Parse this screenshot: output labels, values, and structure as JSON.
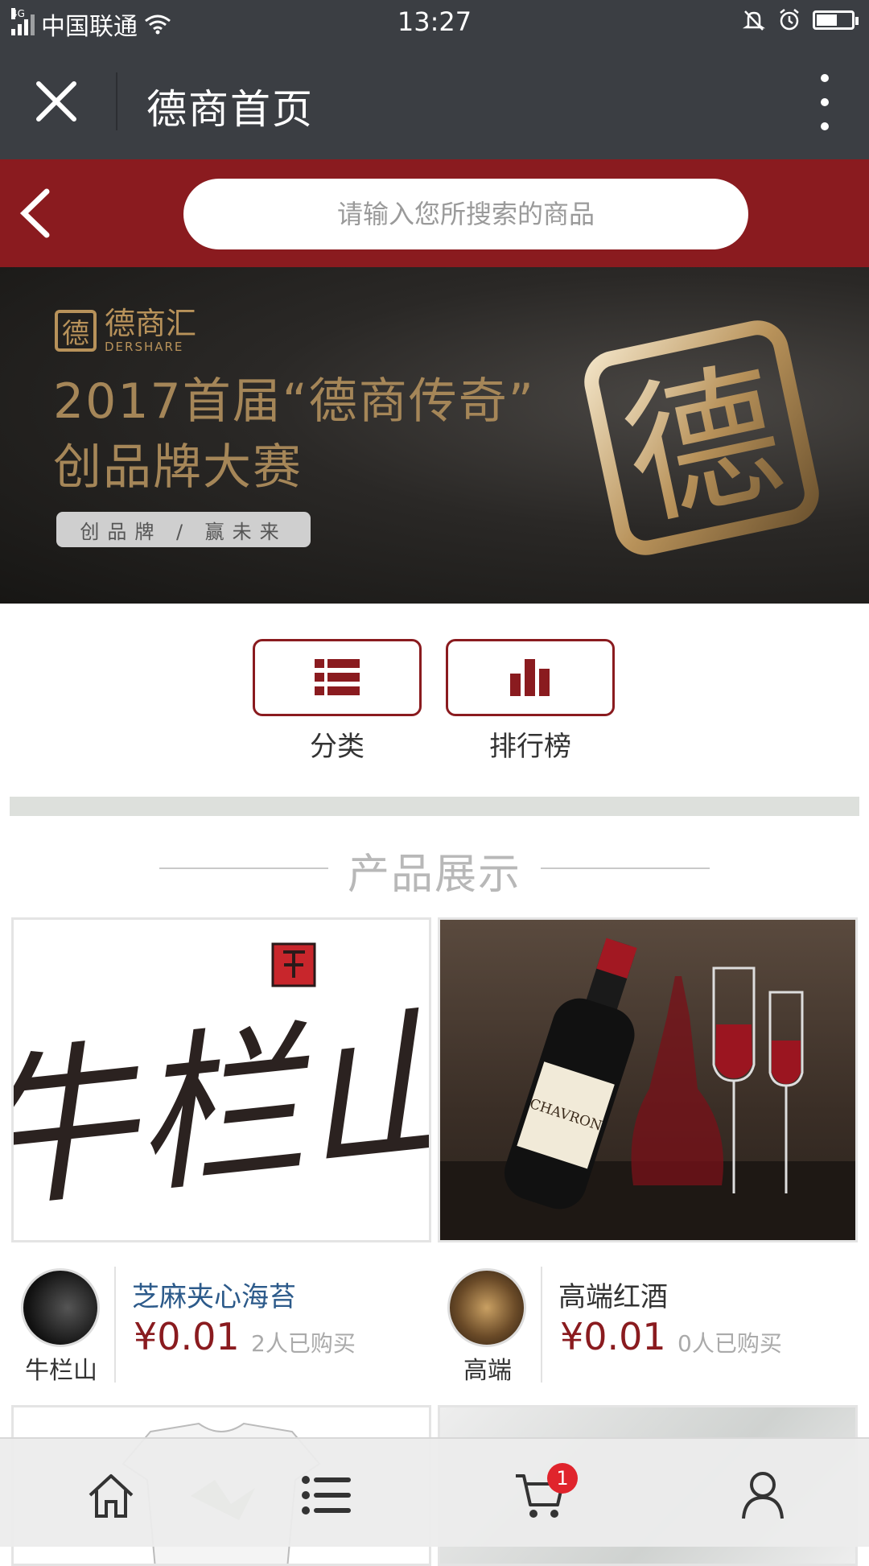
{
  "status_bar": {
    "network": "4G",
    "carrier": "中国联通",
    "time": "13:27",
    "battery_level": 0.55
  },
  "title_bar": {
    "title": "德商首页",
    "close_icon": "close-icon",
    "more_icon": "more-vertical-icon"
  },
  "search": {
    "placeholder": "请输入您所搜索的商品",
    "back_icon": "chevron-left-icon"
  },
  "banner": {
    "brand_cn": "德商汇",
    "brand_en": "DERSHARE",
    "brand_mark": "德",
    "line1": "2017首届“德商传奇”",
    "line2": "创品牌大赛",
    "pill": "创品牌 / 赢未来",
    "emblem_char": "德"
  },
  "quick_actions": [
    {
      "label": "分类",
      "icon": "list-icon"
    },
    {
      "label": "排行榜",
      "icon": "bar-chart-icon"
    }
  ],
  "section": {
    "title": "产品展示"
  },
  "products": [
    {
      "shop": "牛栏山",
      "name": "芝麻夹心海苔",
      "price": "¥0.01",
      "sold": "2人已购买",
      "image_text": "牛栏山"
    },
    {
      "shop": "高端",
      "name": "高端红酒",
      "price": "¥0.01",
      "sold": "0人已购买",
      "image_text": "CHAVRON"
    }
  ],
  "bottom_nav": {
    "items": [
      "home-icon",
      "list-icon",
      "cart-icon",
      "user-icon"
    ],
    "cart_badge": "1"
  },
  "colors": {
    "accent": "#8a1b1f",
    "header": "#3b3e43",
    "badge": "#e0242c"
  }
}
